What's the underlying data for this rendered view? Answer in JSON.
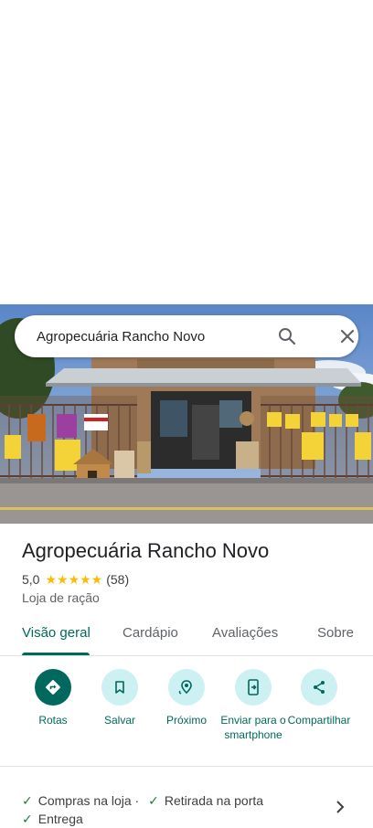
{
  "search": {
    "query": "Agropecuária Rancho Novo"
  },
  "place": {
    "title": "Agropecuária Rancho Novo",
    "rating": "5,0",
    "stars": "★★★★★",
    "review_count": "(58)",
    "category": "Loja de ração"
  },
  "tabs": [
    {
      "label": "Visão geral"
    },
    {
      "label": "Cardápio"
    },
    {
      "label": "Avaliações"
    },
    {
      "label": "Sobre"
    }
  ],
  "actions": [
    {
      "label": "Rotas",
      "icon": "directions-icon"
    },
    {
      "label": "Salvar",
      "icon": "bookmark-icon"
    },
    {
      "label": "Próximo",
      "icon": "nearby-icon"
    },
    {
      "label": "Enviar para o smartphone",
      "icon": "send-to-phone-icon"
    },
    {
      "label": "Compartilhar",
      "icon": "share-icon"
    }
  ],
  "services": [
    {
      "label": "Compras na loja ·"
    },
    {
      "label": "Retirada na porta"
    },
    {
      "label": "Entrega"
    }
  ],
  "colors": {
    "accent": "#00685c",
    "action_bg": "#cdf0f3",
    "star": "#fbbc04",
    "check": "#188038"
  }
}
